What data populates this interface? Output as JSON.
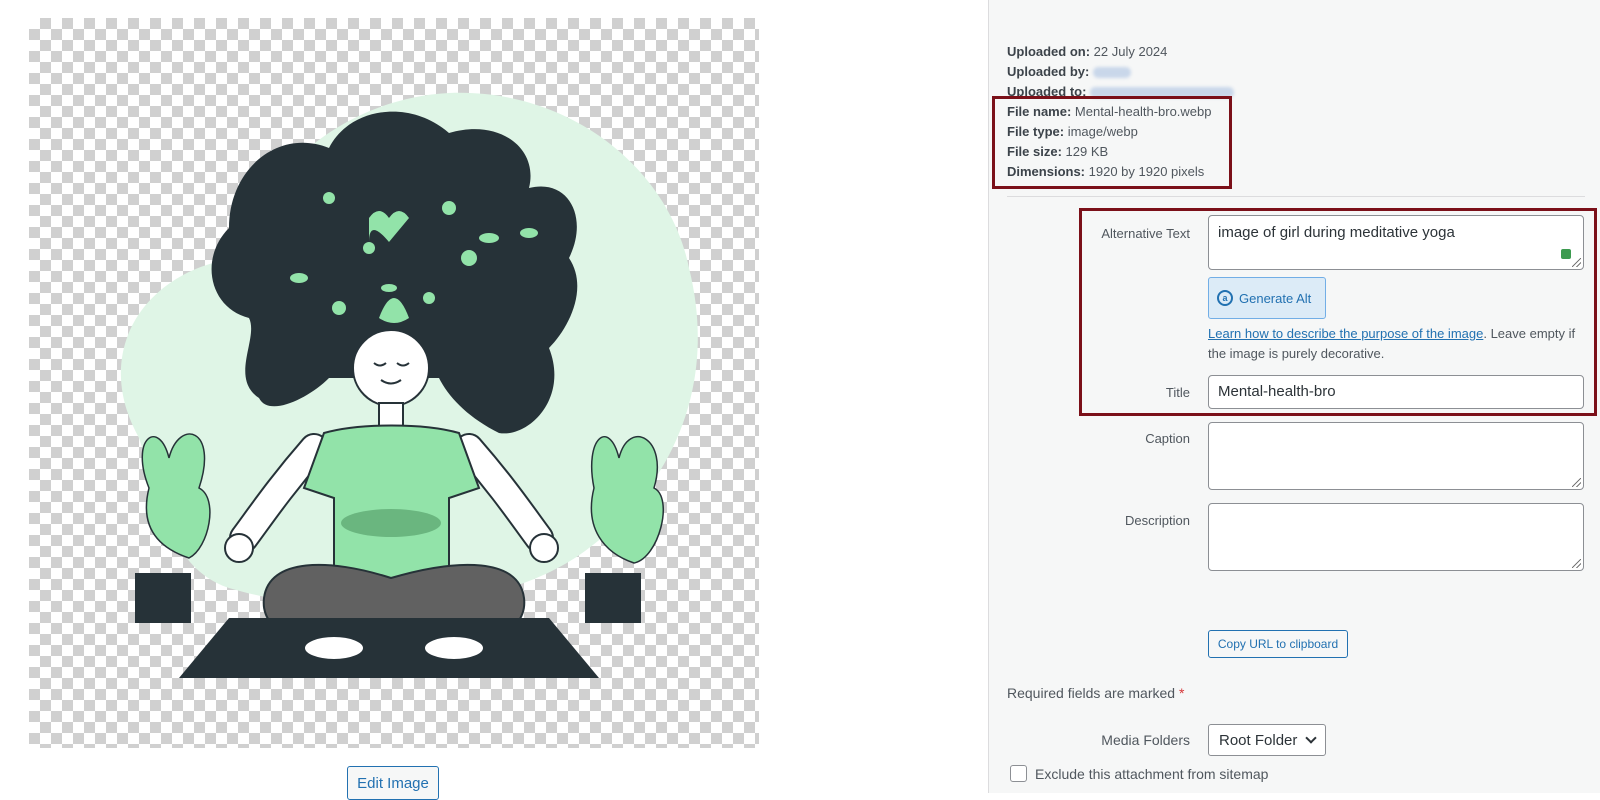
{
  "preview": {
    "edit_button": "Edit Image"
  },
  "details": {
    "uploaded_on_label": "Uploaded on:",
    "uploaded_on_value": "22 July 2024",
    "uploaded_by_label": "Uploaded by:",
    "uploaded_to_label": "Uploaded to:",
    "file_name_label": "File name:",
    "file_name_value": "Mental-health-bro.webp",
    "file_type_label": "File type:",
    "file_type_value": "image/webp",
    "file_size_label": "File size:",
    "file_size_value": "129 KB",
    "dimensions_label": "Dimensions:",
    "dimensions_value": "1920 by 1920 pixels"
  },
  "form": {
    "alt_text_label": "Alternative Text",
    "alt_text_value": "image of girl during meditative yoga",
    "generate_alt_label": "Generate Alt",
    "help_link": "Learn how to describe the purpose of the image",
    "help_text": ". Leave empty if the image is purely decorative.",
    "title_label": "Title",
    "title_value": "Mental-health-bro",
    "caption_label": "Caption",
    "caption_value": "",
    "description_label": "Description",
    "description_value": "",
    "copy_url_label": "Copy URL to clipboard",
    "required_text": "Required fields are marked",
    "required_star": "*",
    "media_folders_label": "Media Folders",
    "media_folders_value": "Root Folder",
    "exclude_sitemap_label": "Exclude this attachment from sitemap"
  },
  "colors": {
    "accent": "#2271b1",
    "highlight_border": "#7b1019",
    "illustration_dark": "#263238",
    "illustration_green": "#92e3a9",
    "illustration_light": "#dff5e6"
  }
}
